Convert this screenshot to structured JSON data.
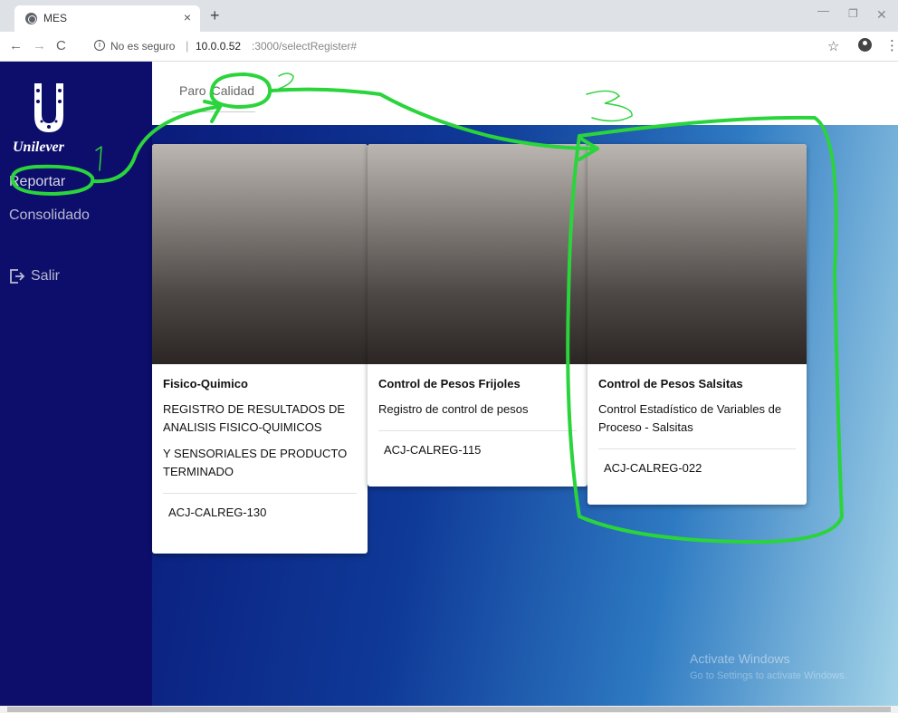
{
  "browser": {
    "tab_title": "MES",
    "tab_close": "×",
    "new_tab": "+",
    "security_text": "No es seguro",
    "url_host": "10.0.0.52",
    "url_rest": ":3000/selectRegister#",
    "icons": [
      "globe-icon",
      "back-icon",
      "forward-icon",
      "reload-icon",
      "info-icon",
      "star-icon",
      "profile-icon",
      "menu-icon"
    ]
  },
  "sidebar": {
    "logo_text": "Unilever",
    "items": [
      {
        "label": "Reportar"
      },
      {
        "label": "Consolidado"
      },
      {
        "label": "Salir"
      }
    ]
  },
  "topbar": {
    "tabs": [
      {
        "label": "Paro"
      },
      {
        "label": "Calidad"
      }
    ]
  },
  "cards": [
    {
      "title": "Fisico-Quimico",
      "description": "REGISTRO DE RESULTADOS DE ANALISIS FISICO-QUIMICOS",
      "description2": "Y SENSORIALES DE PRODUCTO TERMINADO",
      "code": "ACJ-CALREG-130"
    },
    {
      "title": "Control de Pesos Frijoles",
      "description": "Registro de control de pesos",
      "code": "ACJ-CALREG-115"
    },
    {
      "title": "Control de Pesos Salsitas",
      "description": "Control Estadístico de Variables de Proceso - Salsitas",
      "code": "ACJ-CALREG-022"
    }
  ],
  "watermark": {
    "line1": "Activate Windows",
    "line2": "Go to Settings to activate Windows."
  },
  "annotations": {
    "color": "#2ad43b",
    "labels": [
      "1",
      "2",
      "3"
    ]
  },
  "colors": {
    "sidebar": "#0d0e6b",
    "annotation": "#2ad43b"
  }
}
